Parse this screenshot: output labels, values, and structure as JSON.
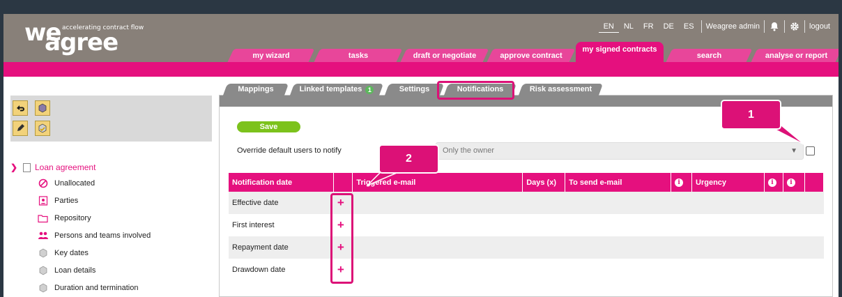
{
  "logo": {
    "we": "we",
    "agree": "agree",
    "tagline": "accelerating contract flow"
  },
  "topbar": {
    "languages": [
      "EN",
      "NL",
      "FR",
      "DE",
      "ES"
    ],
    "active_language": "EN",
    "user": "Weagree admin",
    "logout": "logout",
    "icons": [
      "bell-icon",
      "gear-icon"
    ]
  },
  "main_tabs": [
    "my wizard",
    "tasks",
    "draft or negotiate",
    "approve contract",
    "my signed contracts",
    "search",
    "analyse or report"
  ],
  "active_main_tab": "my signed contracts",
  "sidebar": {
    "root": "Loan agreement",
    "items": [
      {
        "label": "Unallocated",
        "icon": "prohibited-icon"
      },
      {
        "label": "Parties",
        "icon": "person-card-icon"
      },
      {
        "label": "Repository",
        "icon": "folder-icon"
      },
      {
        "label": "Persons and teams involved",
        "icon": "people-icon"
      },
      {
        "label": "Key dates",
        "icon": "cube-icon"
      },
      {
        "label": "Loan details",
        "icon": "cube-icon"
      },
      {
        "label": "Duration and termination",
        "icon": "cube-icon"
      }
    ]
  },
  "sub_tabs": [
    "Mappings",
    "Linked templates",
    "Settings",
    "Notifications",
    "Risk assessment"
  ],
  "linked_templates_count": "1",
  "active_sub_tab": "Notifications",
  "form": {
    "save_label": "Save",
    "override_label": "Override default users to notify",
    "owner_value": "Only the owner"
  },
  "table": {
    "headers": [
      "Notification date",
      "",
      "Triggered e-mail",
      "Days (x)",
      "To send e-mail",
      "i",
      "Urgency",
      "i",
      "i"
    ],
    "rows": [
      "Effective date",
      "First interest",
      "Repayment date",
      "Drawdown date"
    ]
  },
  "callouts": [
    "1",
    "2"
  ],
  "colors": {
    "brand": "#e5107e",
    "header": "#888079",
    "save": "#7cc21c"
  }
}
